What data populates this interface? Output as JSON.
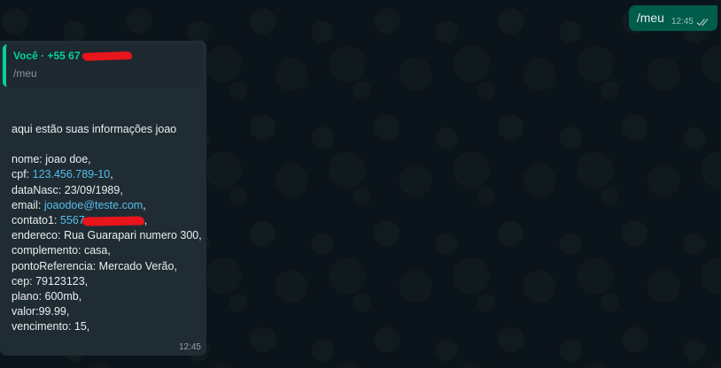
{
  "colors": {
    "background": "#0b141a",
    "outgoing_bubble": "#005c4b",
    "incoming_bubble": "#202c33",
    "quote_accent": "#06cf9c",
    "link": "#53bdeb",
    "redaction": "#e8151c"
  },
  "outgoing": {
    "text": "/meu",
    "time": "12:45",
    "status_icon": "double-check-icon"
  },
  "incoming": {
    "quote": {
      "author": "Você · +55 67",
      "text": "/meu"
    },
    "greeting": "aqui estão suas informações joao",
    "fields": {
      "nome": "nome: joao doe,",
      "cpf_label": "cpf: ",
      "cpf_value": "123.456.789-10",
      "cpf_suffix": ",",
      "datanasc": "dataNasc: 23/09/1989,",
      "email_label": "email: ",
      "email_value": "joaodoe@teste.com",
      "email_suffix": ",",
      "contato_label": "contato1: ",
      "contato_value": "5567",
      "contato_suffix": ",",
      "endereco": "endereco: Rua Guarapari numero 300,",
      "complemento": "complemento: casa,",
      "ponto": "pontoReferencia: Mercado Verão,",
      "cep": "cep: 79123123,",
      "plano": "plano: 600mb,",
      "valor": "valor:99.99,",
      "vencimento": "vencimento: 15,"
    },
    "time": "12:45"
  }
}
